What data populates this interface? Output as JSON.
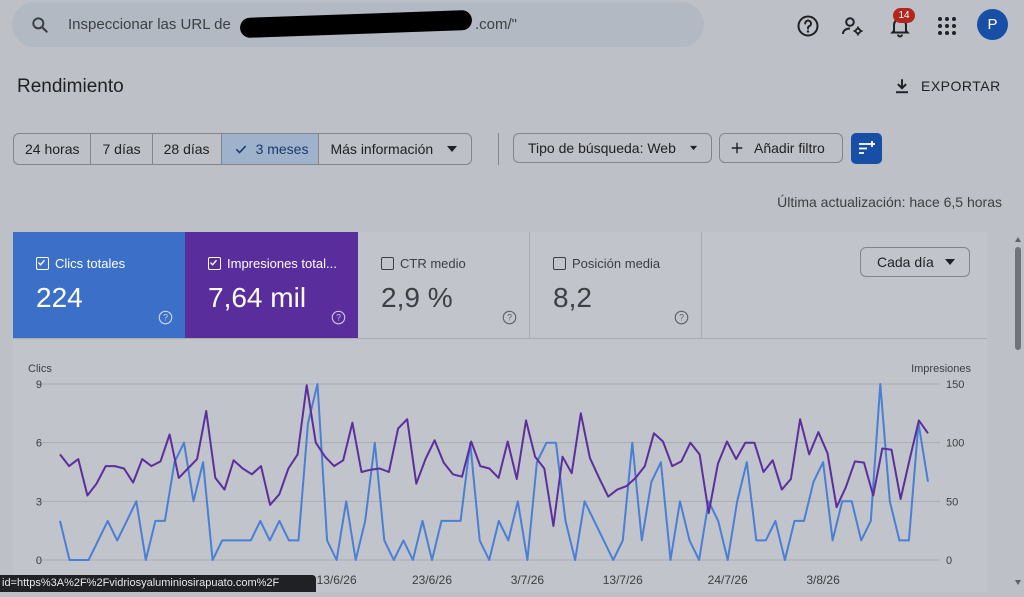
{
  "search": {
    "text": "Inspeccionar las URL de",
    "tail": ".com/\""
  },
  "header": {
    "notifications_count": "14",
    "avatar_letter": "P"
  },
  "page": {
    "title": "Rendimiento",
    "export_label": "EXPORTAR"
  },
  "filters": {
    "date_options": [
      "24 horas",
      "7 días",
      "28 días",
      "3 meses",
      "Más información"
    ],
    "selected_date": "3 meses",
    "search_type": "Tipo de búsqueda: Web",
    "add_filter": "Añadir filtro"
  },
  "last_updated": "Última actualización: hace 6,5 horas",
  "metrics": [
    {
      "label": "Clics totales",
      "value": "224",
      "checked": true,
      "color": "#3c6fc7"
    },
    {
      "label": "Impresiones total...",
      "value": "7,64 mil",
      "checked": true,
      "color": "#5a2d9c"
    },
    {
      "label": "CTR medio",
      "value": "2,9 %",
      "checked": false,
      "color": ""
    },
    {
      "label": "Posición media",
      "value": "8,2",
      "checked": false,
      "color": ""
    }
  ],
  "granularity": "Cada día",
  "chart_data": {
    "type": "line",
    "y_left_label": "Clics",
    "y_right_label": "Impresiones",
    "y_left_ticks": [
      "9",
      "6",
      "3",
      "0"
    ],
    "y_right_ticks": [
      "150",
      "100",
      "50",
      "0"
    ],
    "ylim_left": [
      0,
      9
    ],
    "ylim_right": [
      0,
      150
    ],
    "x_tick_labels": [
      "13/6/26",
      "23/6/26",
      "3/7/26",
      "13/7/26",
      "24/7/26",
      "3/8/26"
    ],
    "x_tick_index": [
      29,
      39,
      49,
      59,
      70,
      80
    ],
    "grid": true,
    "series": [
      {
        "name": "Clics",
        "axis": "left",
        "color": "#4a7fd6",
        "values": [
          2,
          0,
          0,
          0,
          1,
          2,
          1,
          2,
          3,
          0,
          2,
          2,
          5,
          6,
          3,
          5,
          0,
          1,
          1,
          1,
          1,
          2,
          1,
          2,
          1,
          1,
          7,
          9,
          1,
          0,
          3,
          0,
          2,
          6,
          1,
          0,
          1,
          0,
          2,
          0,
          2,
          2,
          2,
          6,
          1,
          0,
          2,
          1,
          3,
          0,
          5,
          6,
          6,
          2,
          0,
          3,
          2,
          1,
          0,
          1,
          6,
          1,
          4,
          5,
          0,
          3,
          1,
          0,
          3,
          2,
          0,
          3,
          5,
          1,
          1,
          2,
          0,
          2,
          2,
          4,
          5,
          1,
          3,
          3,
          1,
          2,
          9,
          3,
          1,
          1,
          7,
          4
        ]
      },
      {
        "name": "Impresiones",
        "axis": "right",
        "color": "#5b2f9e",
        "values": [
          90,
          80,
          86,
          55,
          65,
          80,
          80,
          78,
          66,
          86,
          80,
          84,
          107,
          70,
          78,
          86,
          127,
          70,
          60,
          85,
          78,
          73,
          80,
          47,
          56,
          78,
          90,
          149,
          100,
          88,
          80,
          85,
          117,
          75,
          77,
          78,
          75,
          112,
          120,
          65,
          86,
          102,
          83,
          73,
          71,
          101,
          80,
          78,
          70,
          101,
          69,
          119,
          88,
          78,
          29,
          88,
          74,
          125,
          87,
          70,
          54,
          60,
          63,
          70,
          80,
          108,
          101,
          80,
          84,
          100,
          90,
          40,
          82,
          101,
          86,
          100,
          100,
          75,
          85,
          60,
          69,
          120,
          90,
          109,
          91,
          45,
          62,
          84,
          83,
          55,
          95,
          94,
          52,
          86,
          119,
          108
        ]
      }
    ]
  },
  "status_url": "id=https%3A%2F%2Fvidriosyaluminiosirapuato.com%2F"
}
